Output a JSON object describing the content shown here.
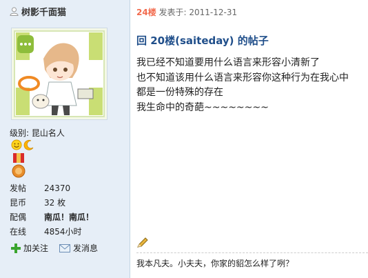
{
  "user": {
    "name": "树影千面猫",
    "level_label": "级别:",
    "level_value": "昆山名人"
  },
  "stats": [
    {
      "key": "发帖",
      "value": "24370"
    },
    {
      "key": "昆币",
      "value": "32 枚"
    },
    {
      "key": "配偶",
      "value": "南瓜！南瓜！"
    },
    {
      "key": "在线",
      "value": "4854小时"
    }
  ],
  "actions": {
    "follow": "加关注",
    "message": "发消息"
  },
  "post": {
    "floor": "24楼",
    "posted_label": "发表于: 2011-12-31",
    "reply_title": "回  20楼(saiteday) 的帖子",
    "lines": [
      "我已经不知道要用什么语言来形容小清新了",
      "也不知道该用什么语言来形容你这种行为在我心中",
      "都是一份特殊的存在",
      "我生命中的奇葩~~~~~~~~"
    ],
    "signature": "我本凡夫。小夫夫，你家的貂怎么样了咧？"
  },
  "icons": {
    "user": "user-icon",
    "follow": "plus-icon",
    "message": "envelope-icon",
    "pencil": "pencil-icon",
    "badges": [
      "smiley-badge-icon",
      "moon-badge-icon"
    ],
    "medal": "medal-icon"
  },
  "colors": {
    "sidebar_bg": "#e6eef7",
    "floor": "#f26c4f",
    "title": "#1f4e8a"
  }
}
